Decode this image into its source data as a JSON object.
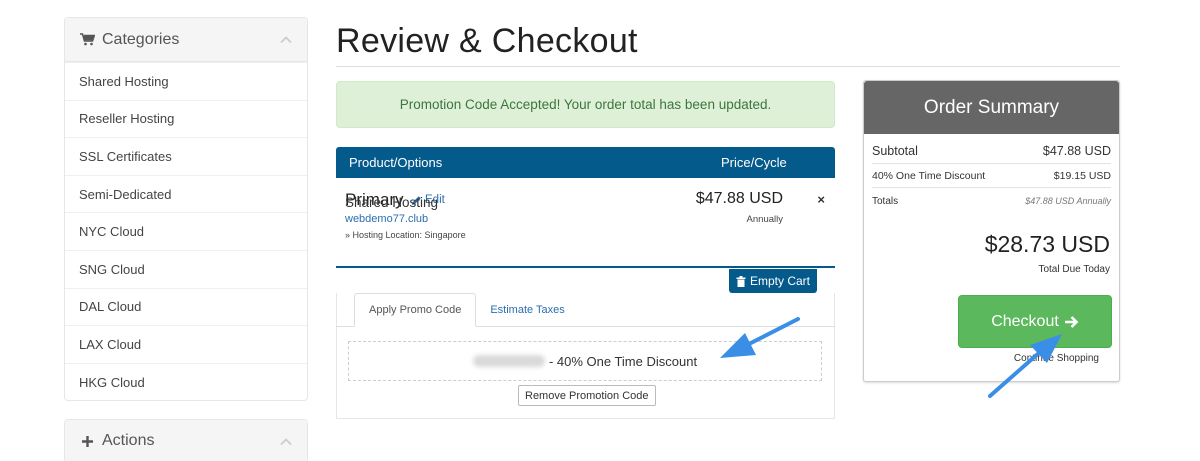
{
  "sidebar": {
    "categories_title": "Categories",
    "categories": [
      {
        "label": "Shared Hosting"
      },
      {
        "label": "Reseller Hosting"
      },
      {
        "label": "SSL Certificates"
      },
      {
        "label": "Semi-Dedicated"
      },
      {
        "label": "NYC Cloud"
      },
      {
        "label": "SNG Cloud"
      },
      {
        "label": "DAL Cloud"
      },
      {
        "label": "LAX Cloud"
      },
      {
        "label": "HKG Cloud"
      }
    ],
    "actions_title": "Actions"
  },
  "page": {
    "title": "Review & Checkout"
  },
  "alert": {
    "message": "Promotion Code Accepted! Your order total has been updated."
  },
  "cart": {
    "col_product": "Product/Options",
    "col_price": "Price/Cycle",
    "item": {
      "name": "Primary",
      "edit_label": "Edit",
      "product": "Shared Hosting",
      "domain": "webdemo77.club",
      "location": "» Hosting Location: Singapore",
      "price": "$47.88 USD",
      "cycle": "Annually",
      "remove": "×"
    },
    "empty_label": "Empty Cart"
  },
  "promo": {
    "tabs": [
      {
        "label": "Apply Promo Code"
      },
      {
        "label": "Estimate Taxes"
      }
    ],
    "applied_text": "- 40% One Time Discount",
    "remove_label": "Remove Promotion Code"
  },
  "summary": {
    "title": "Order Summary",
    "subtotal_label": "Subtotal",
    "subtotal_value": "$47.88 USD",
    "discount_label": "40% One Time Discount",
    "discount_value": "$19.15 USD",
    "totals_label": "Totals",
    "totals_value": "$47.88 USD Annually",
    "total_amount": "$28.73 USD",
    "total_due_label": "Total Due Today",
    "checkout_label": "Checkout",
    "continue_label": "Continue Shopping"
  },
  "colors": {
    "primary": "#055a8c",
    "success": "#5cb85c",
    "alert_bg": "#dff0d8",
    "annotation": "#3a8ee6"
  }
}
